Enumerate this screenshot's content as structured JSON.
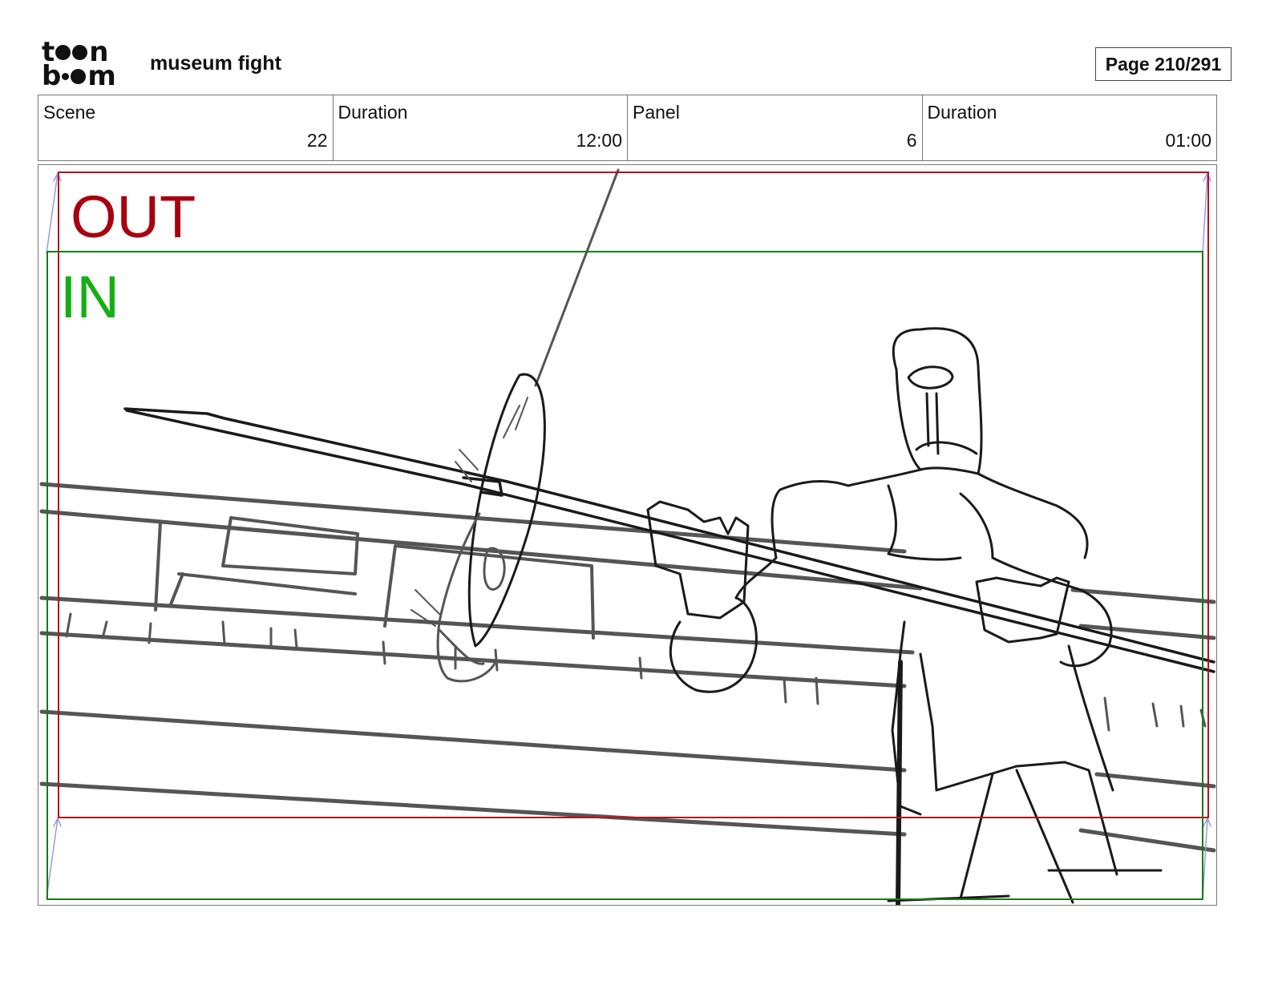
{
  "header": {
    "logo_top": "t",
    "logo_top_end": "n",
    "logo_bottom": "b",
    "logo_bottom_end": "m",
    "project_title": "museum fight",
    "page": "Page 210/291"
  },
  "info": {
    "scene_label": "Scene",
    "scene_value": "22",
    "scene_duration_label": "Duration",
    "scene_duration_value": "12:00",
    "panel_label": "Panel",
    "panel_value": "6",
    "panel_duration_label": "Duration",
    "panel_duration_value": "01:00"
  },
  "panel": {
    "out_label": "OUT",
    "in_label": "IN",
    "colors": {
      "out": "#a8000e",
      "in": "#12b012",
      "sketch": "#1a1a1a"
    }
  }
}
